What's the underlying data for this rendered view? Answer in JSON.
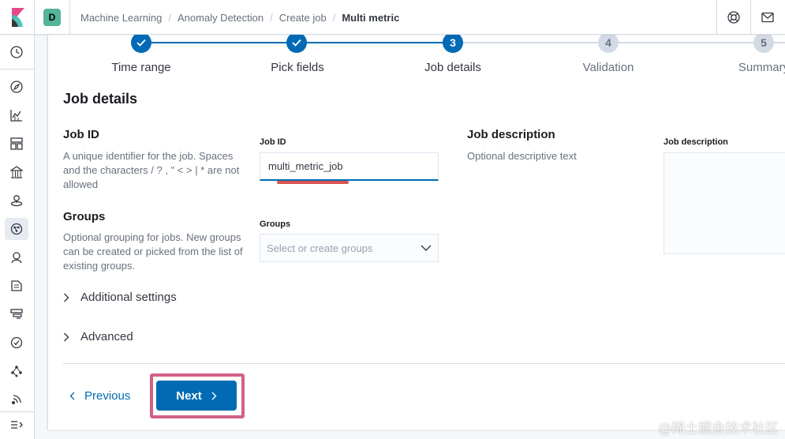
{
  "header": {
    "space_initial": "D",
    "breadcrumbs": [
      "Machine Learning",
      "Anomaly Detection",
      "Create job",
      "Multi metric"
    ],
    "icons": [
      "elastic-logo",
      "help-icon",
      "newsfeed-icon"
    ]
  },
  "sidenav": {
    "items": [
      "recent-icon",
      "discover-icon",
      "visualize-icon",
      "dashboard-icon",
      "canvas-icon",
      "maps-icon",
      "machine-learning-icon",
      "metrics-icon",
      "logs-icon",
      "apm-icon",
      "uptime-icon",
      "graph-icon",
      "monitoring-icon",
      "collapse-icon"
    ],
    "active": "machine-learning-icon"
  },
  "steps": [
    {
      "label": "Time range",
      "state": "done"
    },
    {
      "label": "Pick fields",
      "state": "done"
    },
    {
      "label": "Job details",
      "number": "3",
      "state": "current"
    },
    {
      "label": "Validation",
      "number": "4",
      "state": "todo"
    },
    {
      "label": "Summary",
      "number": "5",
      "state": "todo"
    }
  ],
  "page_title": "Job details",
  "job_id_section": {
    "title": "Job ID",
    "description": "A unique identifier for the job. Spaces and the characters / ? , \" < > | * are not allowed",
    "field_label": "Job ID",
    "value": "multi_metric_job"
  },
  "groups_section": {
    "title": "Groups",
    "description": "Optional grouping for jobs. New groups can be created or picked from the list of existing groups.",
    "field_label": "Groups",
    "placeholder": "Select or create groups"
  },
  "description_section": {
    "title": "Job description",
    "description": "Optional descriptive text",
    "field_label": "Job description",
    "value": ""
  },
  "accordions": [
    "Additional settings",
    "Advanced"
  ],
  "footer": {
    "previous_label": "Previous",
    "next_label": "Next"
  },
  "watermark": "@稀土掘金技术社区",
  "colors": {
    "primary": "#006bb4",
    "highlight": "#d36086",
    "underline_annotation": "#d9534f",
    "space_avatar": "#54b399"
  }
}
